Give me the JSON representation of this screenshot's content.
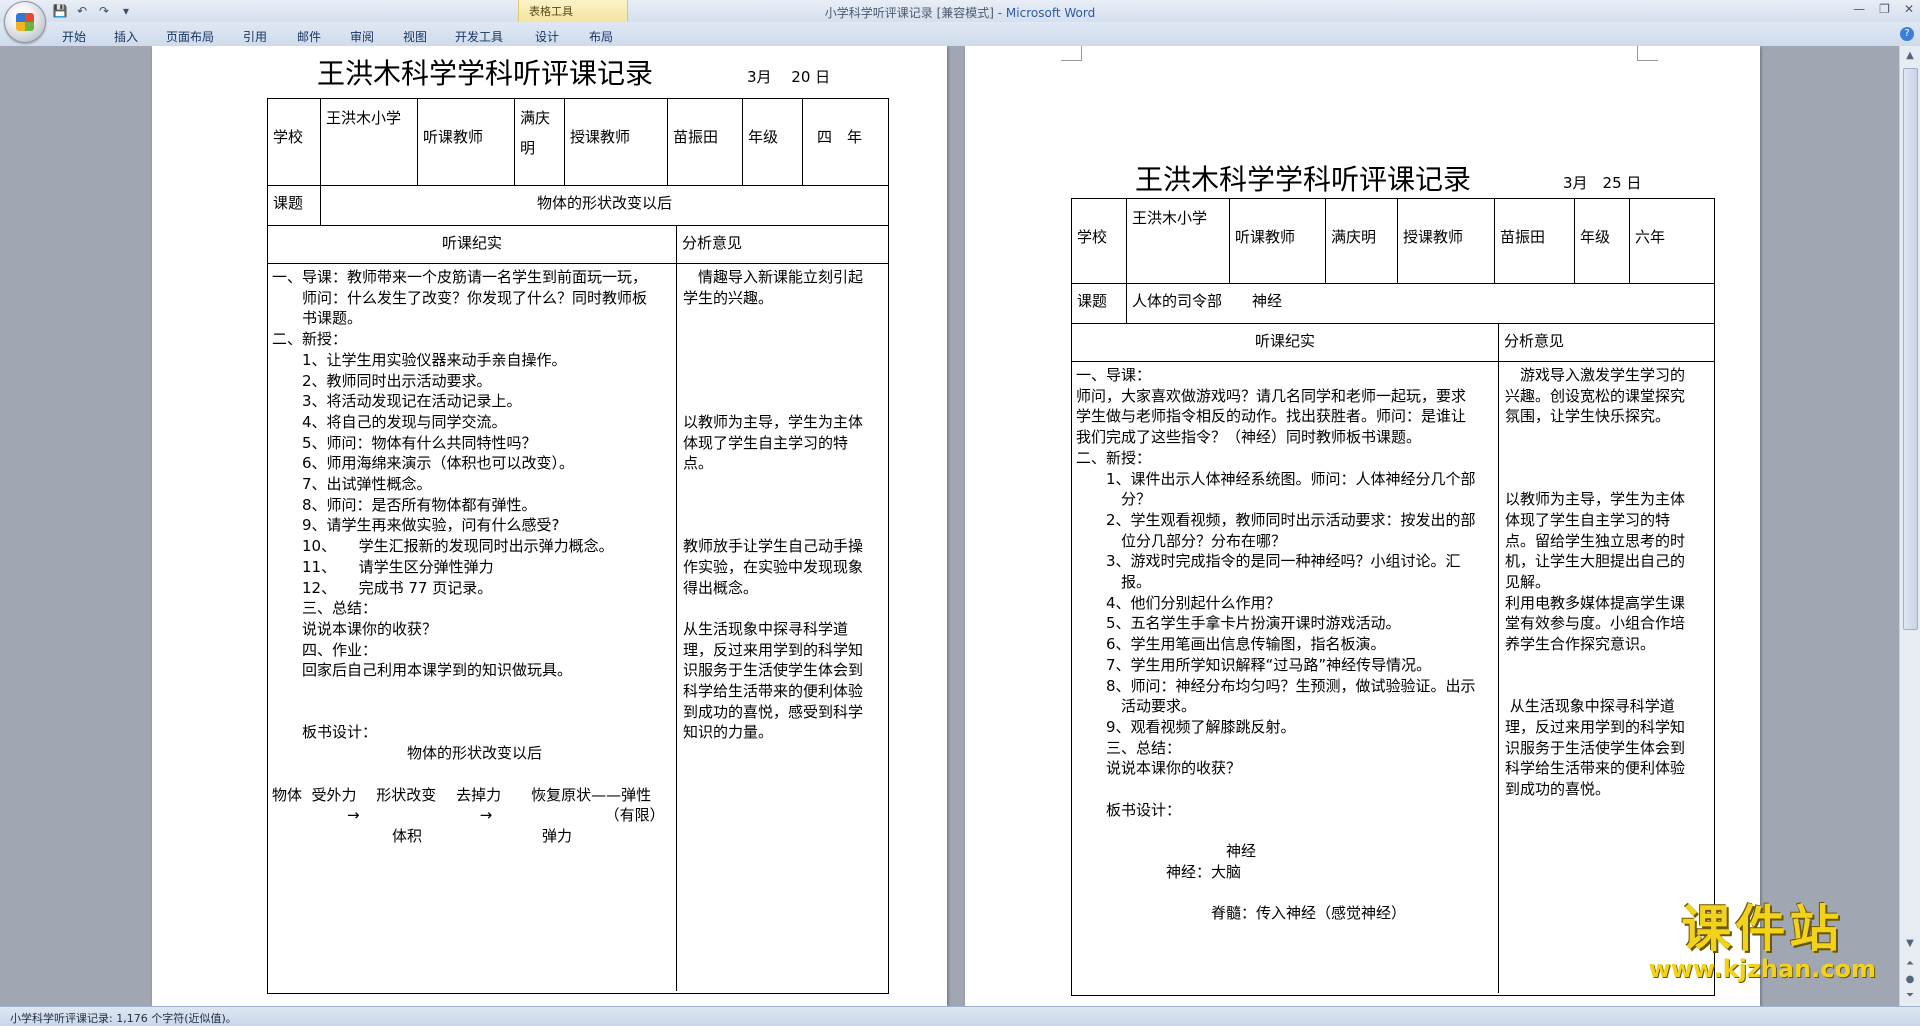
{
  "window": {
    "title": "小学科学听评课记录 [兼容模式]",
    "app": " - Microsoft Word",
    "contextual_group": "表格工具",
    "controls": [
      "—",
      "❐",
      "✕"
    ]
  },
  "ribbon": {
    "tabs": [
      "开始",
      "插入",
      "页面布局",
      "引用",
      "邮件",
      "审阅",
      "视图",
      "开发工具",
      "设计",
      "布局"
    ]
  },
  "status_bar": {
    "text": "小学科学听评课记录: 1,176 个字符(近似值)。"
  },
  "watermark": {
    "text": "课件站",
    "url": "www.kjzhan.com"
  },
  "left_page": {
    "title": "王洪木科学学科听评课记录",
    "date": "3月　 20 日",
    "school_label": "学校",
    "school": "王洪木小学",
    "listener_label": "听课教师",
    "listener": "满庆明",
    "teacher_label": "授课教师",
    "teacher": "苗振田",
    "grade_label": "年级",
    "grade": "四　年",
    "topic_label": "课题",
    "topic": "物体的形状改变以后",
    "record_header": "听课纪实",
    "analysis_header": "分析意见",
    "record": [
      "一、导课：教师带来一个皮筋请一名学生到前面玩一玩，",
      "　　师问：什么发生了改变？你发现了什么？同时教师板",
      "　　书课题。",
      "二、新授：",
      "　　1、让学生用实验仪器来动手亲自操作。",
      "　　2、教师同时出示活动要求。",
      "　　3、将活动发现记在活动记录上。",
      "　　4、将自己的发现与同学交流。",
      "　　5、师问：物体有什么共同特性吗？",
      "　　6、师用海绵来演示（体积也可以改变）。",
      "　　7、出试弹性概念。",
      "　　8、师问：是否所有物体都有弹性。",
      "　　9、请学生再来做实验，问有什么感受?",
      "　　10、　　学生汇报新的发现同时出示弹力概念。",
      "　　11、　　请学生区分弹性弹力",
      "　　12、　　完成书 77 页记录。",
      "　　三、总结：",
      "　　说说本课你的收获？",
      "　　四、作业：",
      "　　回家后自己利用本课学到的知识做玩具。",
      "",
      "",
      "　　板书设计：",
      "　　　　　　　　　物体的形状改变以后",
      "",
      "物体  受外力　 形状改变　 去掉力　　恢复原状——弹性",
      "　　　　　→　　　　　　　　→　　　　　　　　（有限）",
      "　　　　　　　　体积　　　　　　　　弹力"
    ],
    "analysis": [
      "　情趣导入新课能立刻引起",
      "学生的兴趣。",
      "",
      "",
      "",
      "",
      "",
      "以教师为主导，学生为主体",
      "体现了学生自主学习的特",
      "点。",
      "",
      "",
      "",
      "教师放手让学生自己动手操",
      "作实验，在实验中发现现象",
      "得出概念。",
      "",
      "从生活现象中探寻科学道",
      "理，反过来用学到的科学知",
      "识服务于生活使学生体会到",
      "科学给生活带来的便利体验",
      "到成功的喜悦，感受到科学",
      "知识的力量。"
    ]
  },
  "right_page": {
    "title": "王洪木科学学科听评课记录",
    "date": "3月　25 日",
    "school_label": "学校",
    "school": "王洪木小学",
    "listener_label": "听课教师",
    "listener": "满庆明",
    "teacher_label": "授课教师",
    "teacher": "苗振田",
    "grade_label": "年级",
    "grade": "六年",
    "topic_label": "课题",
    "topic": "人体的司令部　　神经",
    "record_header": "听课纪实",
    "analysis_header": "分析意见",
    "record": [
      "一、导课：",
      "师问，大家喜欢做游戏吗？请几名同学和老师一起玩，要求",
      "学生做与老师指令相反的动作。找出获胜者。师问：是谁让",
      "我们完成了这些指令？（神经）同时教师板书课题。",
      "二、新授：",
      "　　1、课件出示人体神经系统图。师问：人体神经分几个部",
      "　　　分？",
      "　　2、学生观看视频，教师同时出示活动要求：按发出的部",
      "　　　位分几部分？分布在哪？",
      "　　3、游戏时完成指令的是同一种神经吗？小组讨论。汇",
      "　　　报。",
      "　　4、他们分别起什么作用？",
      "　　5、五名学生手拿卡片扮演开课时游戏活动。",
      "　　6、学生用笔画出信息传输图，指名板演。",
      "　　7、学生用所学知识解释“过马路”神经传导情况。",
      "　　8、师问：神经分布均匀吗？生预测，做试验验证。出示",
      "　　　活动要求。",
      "　　9、观看视频了解膝跳反射。",
      "　　三、总结：",
      "　　说说本课你的收获？",
      "",
      "　　板书设计：",
      "",
      "　　　　　　　　　　神经",
      "　　　　　　神经：大脑",
      "",
      "　　　　　　　　　脊髓：传入神经（感觉神经）"
    ],
    "analysis": [
      "　游戏导入激发学生学习的",
      "兴趣。创设宽松的课堂探究",
      "氛围，让学生快乐探究。",
      "",
      "",
      "",
      "以教师为主导，学生为主体",
      "体现了学生自主学习的特",
      "点。留给学生独立思考的时",
      "机，让学生大胆提出自己的",
      "见解。",
      "利用电教多媒体提高学生课",
      "堂有效参与度。小组合作培",
      "养学生合作探究意识。",
      "",
      "",
      " 从生活现象中探寻科学道",
      "理，反过来用学到的科学知",
      "识服务于生活使学生体会到",
      "科学给生活带来的便利体验",
      "到成功的喜悦。"
    ]
  },
  "icons": {
    "save": "save-icon",
    "undo": "undo-icon",
    "redo": "redo-icon",
    "help": "help-icon"
  },
  "colors": {
    "accent": "#2d5ba0",
    "watermark": "#f2d21a",
    "ribbon": "#cfdbeb"
  }
}
